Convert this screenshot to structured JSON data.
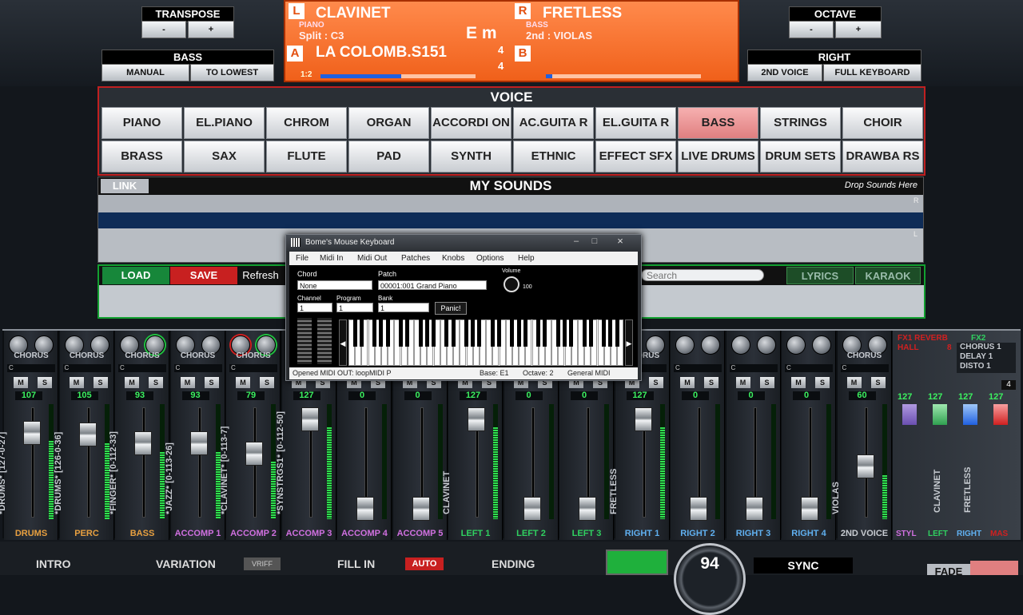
{
  "transpose": {
    "title": "TRANSPOSE",
    "minus": "-",
    "plus": "+"
  },
  "octave": {
    "title": "OCTAVE",
    "minus": "-",
    "plus": "+"
  },
  "bass_panel": {
    "title": "BASS",
    "btn1": "MANUAL",
    "btn2": "TO LOWEST"
  },
  "right_panel": {
    "title": "RIGHT",
    "btn1": "2ND VOICE",
    "btn2": "FULL KEYBOARD"
  },
  "display": {
    "l_badge": "L",
    "left_voice": "CLAVINET",
    "left_cat": "PIANO",
    "split": "Split : C3",
    "key": "E m",
    "r_badge": "R",
    "right_voice": "FRETLESS",
    "right_cat": "BASS",
    "second": "2nd : VIOLAS",
    "a_badge": "A",
    "style": "LA COLOMB.S151",
    "time_top": "4",
    "time_bottom": "4",
    "b_badge": "B",
    "ratio": "1:2"
  },
  "voice": {
    "title": "VOICE",
    "row1": [
      "PIANO",
      "EL.PIANO",
      "CHROM",
      "ORGAN",
      "ACCORDI ON",
      "AC.GUITA R",
      "EL.GUITA R",
      "BASS",
      "STRINGS",
      "CHOIR"
    ],
    "row2": [
      "BRASS",
      "SAX",
      "FLUTE",
      "PAD",
      "SYNTH",
      "ETHNIC",
      "EFFECT SFX",
      "LIVE DRUMS",
      "DRUM SETS",
      "DRAWBA RS"
    ]
  },
  "mysounds": {
    "link": "LINK",
    "title": "MY SOUNDS",
    "drop": "Drop Sounds Here",
    "r": "R",
    "l": "L"
  },
  "lowbar": {
    "load": "LOAD",
    "save": "SAVE",
    "refresh": "Refresh",
    "search_placeholder": "Search",
    "lyrics": "LYRICS",
    "karaoke": "KARAOK"
  },
  "bome": {
    "title": "Bome's Mouse Keyboard",
    "menu": [
      "File",
      "Midi In",
      "Midi Out",
      "Patches",
      "Knobs",
      "Options",
      "Help"
    ],
    "chord_label": "Chord",
    "chord_value": "None",
    "patch_label": "Patch",
    "patch_value": "00001:001 Grand Piano",
    "volume_label": "Volume",
    "volume_value": "100",
    "channel_label": "Channel",
    "channel_value": "1",
    "program_label": "Program",
    "program_value": "1",
    "bank_label": "Bank",
    "bank_value": "1",
    "panic": "Panic!",
    "status": "Opened MIDI OUT: loopMIDI P",
    "base": "Base: E1",
    "octave": "Octave: 2",
    "gm": "General MIDI"
  },
  "mixer": {
    "strips": [
      {
        "fx": "CHORUS",
        "vol": "107",
        "name": "*DRUMS* [127-0-27]",
        "label": "DRUMS",
        "color": "#e8a040",
        "level": 0.85
      },
      {
        "fx": "CHORUS",
        "vol": "105",
        "name": "*DRUMS* [126-0-36]",
        "label": "PERC",
        "color": "#e8a040",
        "level": 0.83
      },
      {
        "fx": "CHORUS",
        "vol": "93",
        "name": "*FINGER* [0-112-33]",
        "label": "BASS",
        "color": "#e8a040",
        "level": 0.73
      },
      {
        "fx": "CHORUS",
        "vol": "93",
        "name": "*JAZZ* [0-113-26]",
        "label": "ACCOMP 1",
        "color": "#d070e0",
        "level": 0.73
      },
      {
        "fx": "CHORUS",
        "vol": "79",
        "name": "*CLAVINET* [0-113-7]",
        "label": "ACCOMP 2",
        "color": "#d070e0",
        "level": 0.62
      },
      {
        "fx": "",
        "vol": "127",
        "name": "*SYNSTRGS1* [0-112-50]",
        "label": "ACCOMP 3",
        "color": "#d070e0",
        "level": 1.0
      },
      {
        "fx": "",
        "vol": "0",
        "name": "",
        "label": "ACCOMP 4",
        "color": "#d070e0",
        "level": 0.0
      },
      {
        "fx": "",
        "vol": "0",
        "name": "",
        "label": "ACCOMP 5",
        "color": "#d070e0",
        "level": 0.0
      },
      {
        "fx": "",
        "vol": "127",
        "name": "CLAVINET",
        "label": "LEFT 1",
        "color": "#30d060",
        "level": 1.0
      },
      {
        "fx": "",
        "vol": "0",
        "name": "",
        "label": "LEFT 2",
        "color": "#30d060",
        "level": 0.0
      },
      {
        "fx": "",
        "vol": "0",
        "name": "",
        "label": "LEFT 3",
        "color": "#30d060",
        "level": 0.0
      },
      {
        "fx": "CHORUS",
        "vol": "127",
        "name": "FRETLESS",
        "label": "RIGHT 1",
        "color": "#60b0f0",
        "level": 1.0
      },
      {
        "fx": "",
        "vol": "0",
        "name": "",
        "label": "RIGHT 2",
        "color": "#60b0f0",
        "level": 0.0
      },
      {
        "fx": "",
        "vol": "0",
        "name": "",
        "label": "RIGHT 3",
        "color": "#60b0f0",
        "level": 0.0
      },
      {
        "fx": "",
        "vol": "0",
        "name": "",
        "label": "RIGHT 4",
        "color": "#60b0f0",
        "level": 0.0
      },
      {
        "fx": "CHORUS",
        "vol": "60",
        "name": "VIOLAS",
        "label": "2ND VOICE",
        "color": "#c8ccd2",
        "level": 0.47
      }
    ],
    "mute": "M",
    "solo": "S",
    "c": "C"
  },
  "fx_panel": {
    "rev": "FX1 REVERB",
    "hall": "HALL",
    "b": "8",
    "fx2": "FX2",
    "fx_items": [
      "CHORUS 1",
      "DELAY 1",
      "DISTO 1"
    ],
    "master": {
      "four": "4",
      "vols": [
        "127",
        "127",
        "127",
        "127"
      ],
      "names": [
        "CLAVINET",
        "FRETLESS"
      ],
      "labels": [
        "STYL",
        "LEFT",
        "RIGHT",
        "MAS"
      ]
    }
  },
  "bottom": {
    "intro": "INTRO",
    "variation": "VARIATION",
    "vriff": "VRIFF",
    "fill": "FILL IN",
    "auto": "AUTO",
    "ending": "ENDING",
    "tempo": "94",
    "sync": "SYNC",
    "fade": "FADE"
  }
}
